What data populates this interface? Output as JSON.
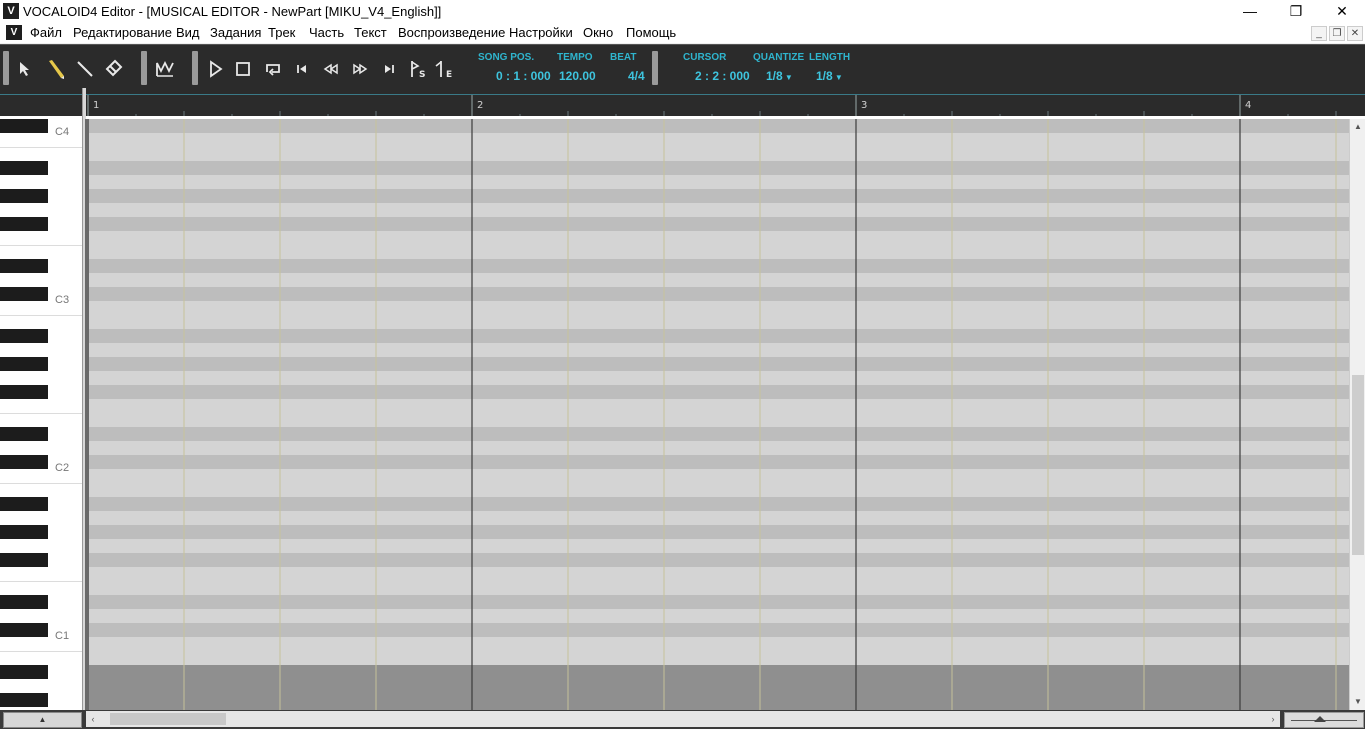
{
  "window": {
    "title": "VOCALOID4 Editor - [MUSICAL EDITOR - NewPart [MIKU_V4_English]]",
    "app_icon_letter": "V"
  },
  "menu": {
    "items": [
      "Файл",
      "Редактирование",
      "Вид",
      "Задания",
      "Трек",
      "Часть",
      "Текст",
      "Воспроизведение",
      "Настройки",
      "Окно",
      "Помощь"
    ]
  },
  "toolbar": {
    "song_pos": {
      "label": "SONG POS.",
      "value": "0 : 1 : 000"
    },
    "tempo": {
      "label": "TEMPO",
      "value": "120.00"
    },
    "beat": {
      "label": "BEAT",
      "value": "4/4"
    },
    "cursor": {
      "label": "CURSOR",
      "value": "2 : 2 : 000"
    },
    "quantize": {
      "label": "QUANTIZE",
      "value": "1/8"
    },
    "length": {
      "label": "LENGTH",
      "value": "1/8"
    },
    "tools": [
      "arrow-tool-icon",
      "pencil-tool-icon",
      "line-tool-icon",
      "eraser-tool-icon",
      "vibrato-tool-icon"
    ],
    "transport": [
      "play-icon",
      "stop-icon",
      "loop-icon",
      "go-to-start-icon",
      "rewind-icon",
      "fast-forward-icon",
      "go-to-end-icon",
      "start-marker-icon",
      "end-marker-icon"
    ],
    "accent_color": "#3ec4de"
  },
  "ruler": {
    "measures": [
      "1",
      "2",
      "3",
      "4"
    ]
  },
  "keyboard": {
    "octave_labels": [
      "C4",
      "C3",
      "C2",
      "C1"
    ]
  },
  "colors": {
    "toolbar_bg": "#2b2b2b",
    "white_row": "#d4d4d4",
    "black_row": "#bdbdbd",
    "outside_row": "#8f8f8f",
    "measure_line": "#3c3c3c",
    "beat_line": "#c6c29a"
  }
}
